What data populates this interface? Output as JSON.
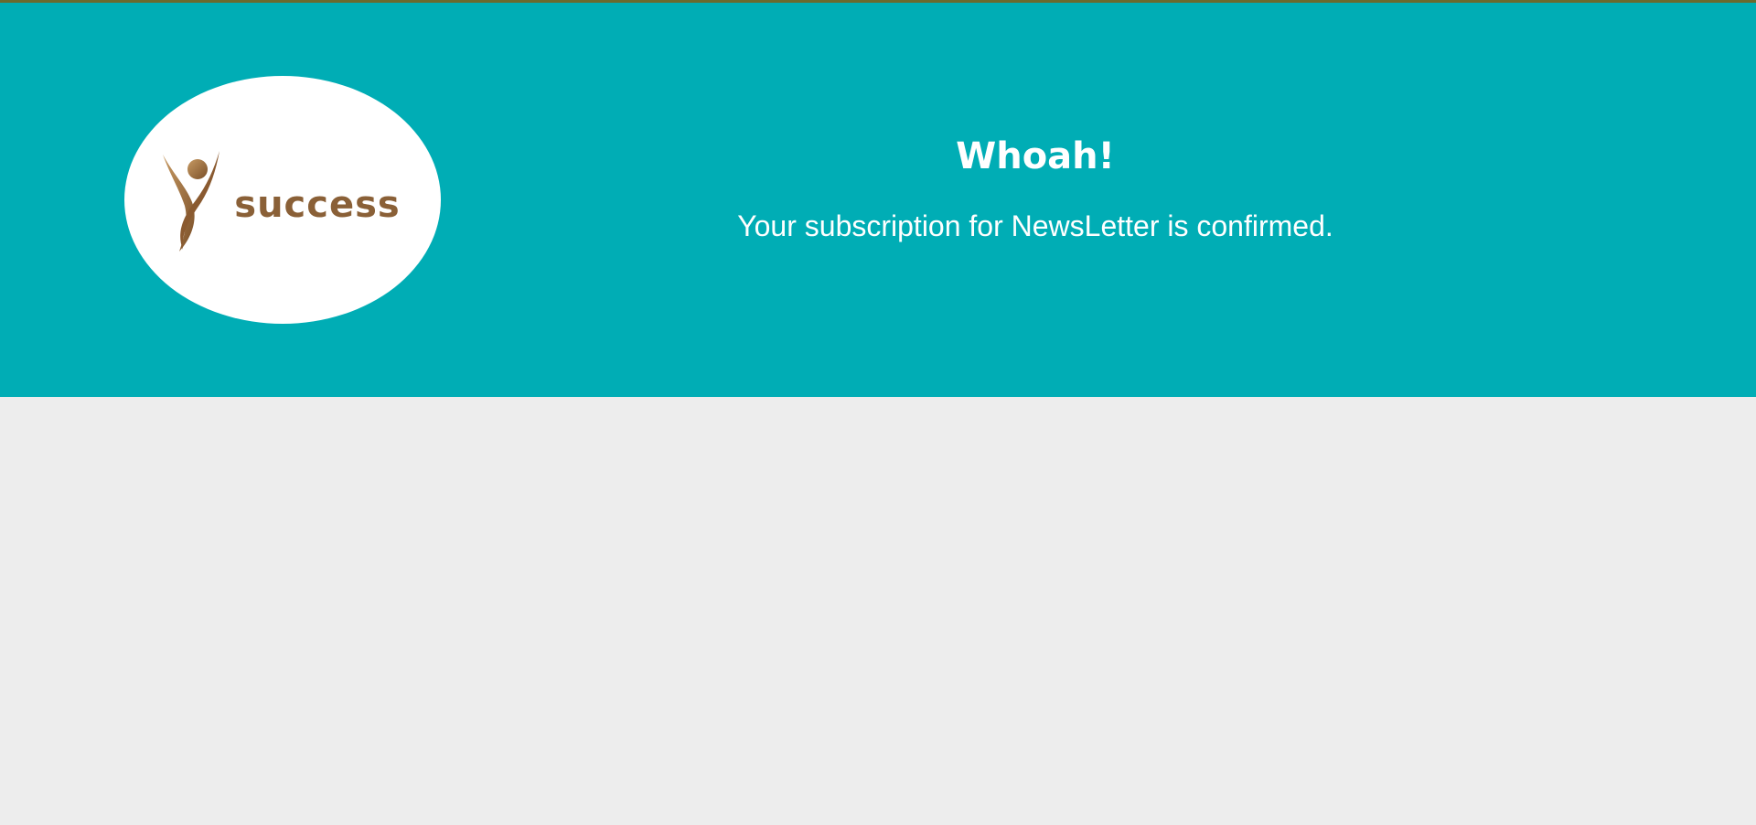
{
  "logo": {
    "text": "success",
    "icon": "success-figure-icon",
    "color": "#8a6037"
  },
  "confirmation": {
    "headline": "Whoah!",
    "message": "Your subscription for NewsLetter is confirmed."
  },
  "colors": {
    "banner": "#00adb5",
    "page_background": "#ededed",
    "text": "#ffffff"
  }
}
